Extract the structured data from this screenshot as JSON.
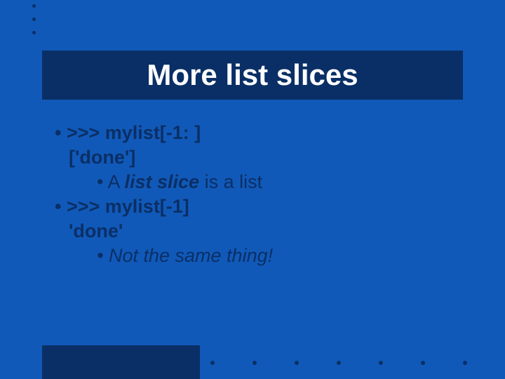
{
  "slide": {
    "title": "More list slices",
    "bullet1_code": ">>> mylist[-1: ]",
    "bullet1_output": "['done']",
    "sub1_prefix": "A ",
    "sub1_emph": "list slice",
    "sub1_suffix": " is a list",
    "bullet2_code": ">>> mylist[-1]",
    "bullet2_output": "'done'",
    "sub2_text": "Not the same thing!"
  }
}
